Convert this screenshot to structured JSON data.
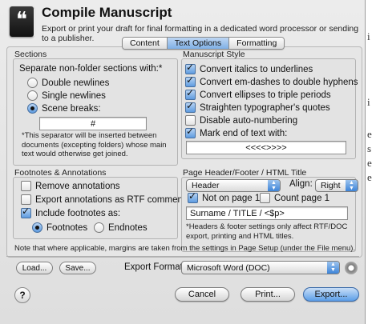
{
  "window": {
    "title": "Compile Manuscript",
    "subtitle": "Export or print your draft for final formatting in a dedicated word processor or sending to a publisher."
  },
  "tabs": [
    {
      "label": "Content",
      "active": false
    },
    {
      "label": "Text Options",
      "active": true
    },
    {
      "label": "Formatting",
      "active": false
    }
  ],
  "sections": {
    "title": "Sections",
    "separator_label": "Separate non-folder sections with:*",
    "options": [
      {
        "label": "Double newlines",
        "selected": false
      },
      {
        "label": "Single newlines",
        "selected": false
      },
      {
        "label": "Scene breaks:",
        "selected": true
      }
    ],
    "scene_break_value": "#",
    "note": "*This separator will be inserted between documents (excepting folders) whose main text would otherwise get joined."
  },
  "manuscript_style": {
    "title": "Manuscript Style",
    "options": [
      {
        "label": "Convert italics to underlines",
        "checked": true
      },
      {
        "label": "Convert em-dashes to double hyphens",
        "checked": true
      },
      {
        "label": "Convert ellipses to triple periods",
        "checked": true
      },
      {
        "label": "Straighten typographer's quotes",
        "checked": true
      },
      {
        "label": "Disable auto-numbering",
        "checked": false
      },
      {
        "label": "Mark end of text with:",
        "checked": true
      }
    ],
    "end_mark_value": "<<<<>>>>"
  },
  "footnotes": {
    "title": "Footnotes & Annotations",
    "options": [
      {
        "label": "Remove annotations",
        "checked": false
      },
      {
        "label": "Export annotations as RTF comments",
        "checked": false
      },
      {
        "label": "Include footnotes as:",
        "checked": true
      }
    ],
    "radio": [
      {
        "label": "Footnotes",
        "selected": true
      },
      {
        "label": "Endnotes",
        "selected": false
      }
    ]
  },
  "header_footer": {
    "title": "Page Header/Footer / HTML Title",
    "location_value": "Header",
    "align_label": "Align:",
    "align_value": "Right",
    "not_on_page1_label": "Not on page 1",
    "not_on_page1_checked": true,
    "count_page1_label": "Count page 1",
    "count_page1_checked": false,
    "header_text": "Surname / TITLE / <$p>",
    "note": "*Headers & footer settings only affect RTF/DOC export, printing and HTML titles."
  },
  "footer_note": "Note that where applicable, margins are taken from the settings in Page Setup (under the File menu).",
  "export": {
    "load_label": "Load...",
    "save_label": "Save...",
    "format_label": "Export Format:",
    "format_value": "Microsoft Word (DOC)"
  },
  "buttons": {
    "help": "?",
    "cancel": "Cancel",
    "print": "Print...",
    "export": "Export..."
  },
  "background_window_fragments": [
    "i",
    "i",
    "e",
    "s",
    "e",
    "e"
  ]
}
